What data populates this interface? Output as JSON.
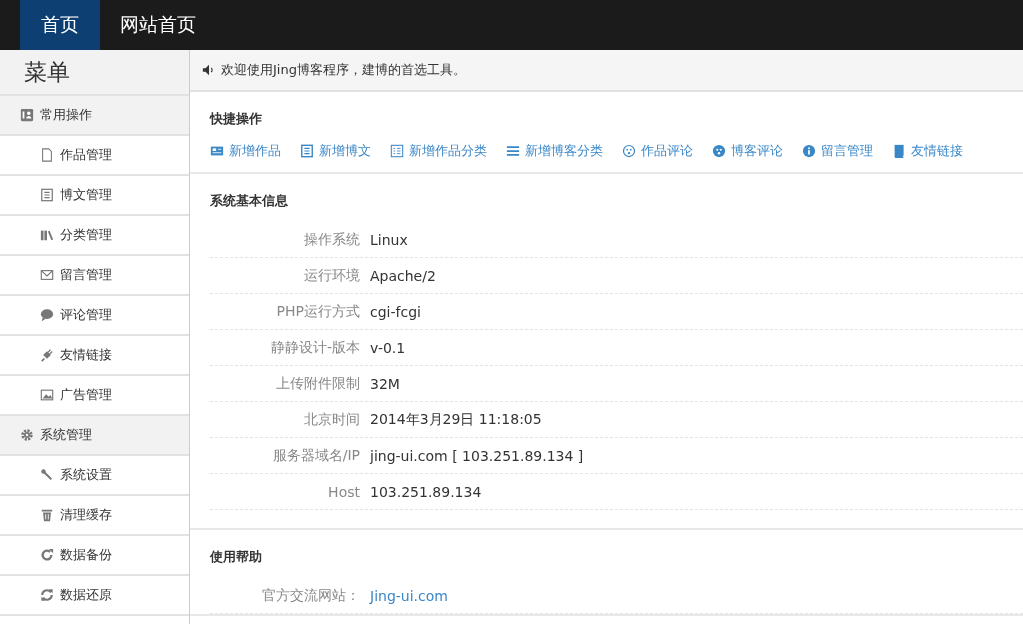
{
  "topnav": [
    {
      "label": "首页",
      "selected": true
    },
    {
      "label": "网站首页",
      "selected": false
    }
  ],
  "sidebar": {
    "title": "菜单",
    "items": [
      {
        "kind": "group",
        "label": "常用操作"
      },
      {
        "kind": "item",
        "label": "作品管理"
      },
      {
        "kind": "item",
        "label": "博文管理"
      },
      {
        "kind": "item",
        "label": "分类管理"
      },
      {
        "kind": "item",
        "label": "留言管理"
      },
      {
        "kind": "item",
        "label": "评论管理"
      },
      {
        "kind": "item",
        "label": "友情链接"
      },
      {
        "kind": "item",
        "label": "广告管理"
      },
      {
        "kind": "group",
        "label": "系统管理"
      },
      {
        "kind": "item",
        "label": "系统设置"
      },
      {
        "kind": "item",
        "label": "清理缓存"
      },
      {
        "kind": "item",
        "label": "数据备份"
      },
      {
        "kind": "item",
        "label": "数据还原"
      }
    ]
  },
  "notice": "欢迎使用Jing博客程序，建博的首选工具。",
  "quick_actions": {
    "title": "快捷操作",
    "items": [
      "新增作品",
      "新增博文",
      "新增作品分类",
      "新增博客分类",
      "作品评论",
      "博客评论",
      "留言管理",
      "友情链接"
    ]
  },
  "system_info": {
    "title": "系统基本信息",
    "rows": [
      {
        "label": "操作系统",
        "value": "Linux"
      },
      {
        "label": "运行环境",
        "value": "Apache/2"
      },
      {
        "label": "PHP运行方式",
        "value": "cgi-fcgi"
      },
      {
        "label": "静静设计-版本",
        "value": "v-0.1"
      },
      {
        "label": "上传附件限制",
        "value": "32M"
      },
      {
        "label": "北京时间",
        "value": "2014年3月29日 11:18:05"
      },
      {
        "label": "服务器域名/IP",
        "value": "jing-ui.com [ 103.251.89.134 ]"
      },
      {
        "label": "Host",
        "value": "103.251.89.134"
      }
    ]
  },
  "help": {
    "title": "使用帮助",
    "rows": [
      {
        "label": "官方交流网站：",
        "link": "Jing-ui.com"
      }
    ]
  }
}
